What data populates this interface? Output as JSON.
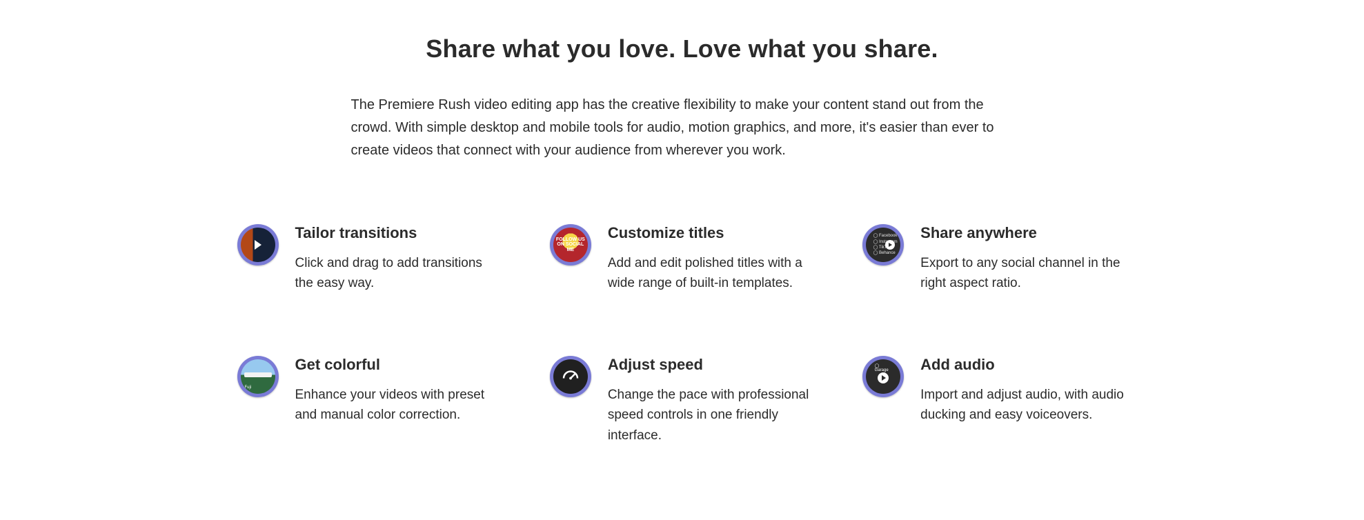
{
  "headline": "Share what you love. Love what you share.",
  "intro": "The Premiere Rush video editing app has the creative flexibility to make your content stand out from the crowd. With simple desktop and mobile tools for audio, motion graphics, and more, it's easier than ever to create videos that connect with your audience from wherever you work.",
  "features": [
    {
      "title": "Tailor transitions",
      "desc": "Click and drag to add transitions the easy way."
    },
    {
      "title": "Customize titles",
      "desc": "Add and edit polished titles with a wide range of built-in templates."
    },
    {
      "title": "Share anywhere",
      "desc": "Export to any social channel in the right aspect ratio."
    },
    {
      "title": "Get colorful",
      "desc": "Enhance your videos with preset and manual color correction."
    },
    {
      "title": "Adjust speed",
      "desc": "Change the pace with professional speed controls in one friendly interface."
    },
    {
      "title": "Add audio",
      "desc": "Import and adjust audio, with audio ducking and easy voiceovers."
    }
  ]
}
